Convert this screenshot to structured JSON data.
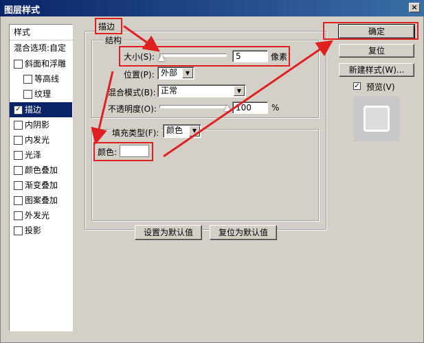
{
  "window": {
    "title": "图层样式",
    "close_glyph": "×"
  },
  "left_panel": {
    "header": "样式",
    "blend_options": "混合选项:自定",
    "items": [
      {
        "label": "斜面和浮雕",
        "checked": false
      },
      {
        "label": "等高线",
        "checked": false
      },
      {
        "label": "纹理",
        "checked": false
      },
      {
        "label": "描边",
        "checked": true,
        "selected": true
      },
      {
        "label": "内阴影",
        "checked": false
      },
      {
        "label": "内发光",
        "checked": false
      },
      {
        "label": "光泽",
        "checked": false
      },
      {
        "label": "颜色叠加",
        "checked": false
      },
      {
        "label": "渐变叠加",
        "checked": false
      },
      {
        "label": "图案叠加",
        "checked": false
      },
      {
        "label": "外发光",
        "checked": false
      },
      {
        "label": "投影",
        "checked": false
      }
    ],
    "check_glyph": "✓"
  },
  "stroke": {
    "section_title": "描边",
    "structure_title": "结构",
    "size_label": "大小(S):",
    "size_value": "5",
    "size_unit": "像素",
    "position_label": "位置(P):",
    "position_value": "外部",
    "blend_mode_label": "混合模式(B):",
    "blend_mode_value": "正常",
    "opacity_label": "不透明度(O):",
    "opacity_value": "100",
    "opacity_unit": "%",
    "fill_type_label": "填充类型(F):",
    "fill_type_value": "颜色",
    "color_label": "颜色:",
    "color_swatch": "#ffffff",
    "set_default_button": "设置为默认值",
    "reset_default_button": "复位为默认值"
  },
  "actions": {
    "ok_button": "确定",
    "reset_button": "复位",
    "new_style_button": "新建样式(W)...",
    "preview_label": "预览(V)",
    "preview_checked": true
  },
  "annotation_color": "#e02020"
}
